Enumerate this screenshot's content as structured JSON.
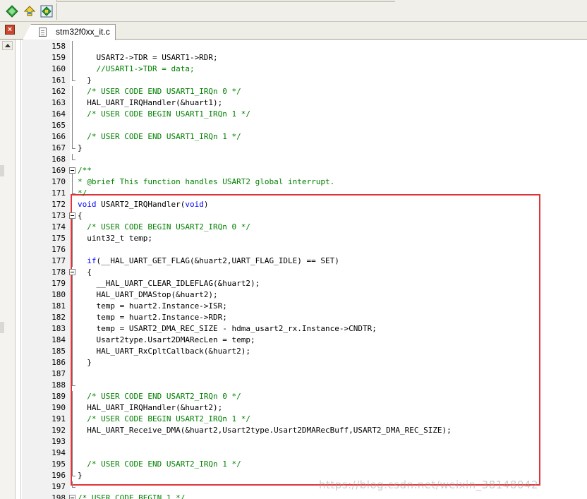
{
  "editor": {
    "tab_title": "stm32f0xx_it.c",
    "close_glyph": "×",
    "watermark": "https://blog.csdn.net/weixin_38148042",
    "colors": {
      "comment": "#008000",
      "keyword": "#0000ff",
      "highlight_border": "#e0343a"
    },
    "icons": [
      "navigate-green-icon",
      "bookmark-up-icon",
      "bookmark-window-icon",
      "file-icon",
      "close-icon",
      "scroll-up-icon"
    ],
    "lines": [
      {
        "n": "158",
        "fold": "line",
        "parts": []
      },
      {
        "n": "159",
        "fold": "line",
        "parts": [
          {
            "t": "    USART2->TDR = USART1->RDR;"
          }
        ]
      },
      {
        "n": "160",
        "fold": "line",
        "parts": [
          {
            "t": "    "
          },
          {
            "t": "//USART1->TDR = data;",
            "c": "com"
          }
        ]
      },
      {
        "n": "161",
        "fold": "end",
        "parts": [
          {
            "t": "  }"
          }
        ]
      },
      {
        "n": "162",
        "fold": "line",
        "parts": [
          {
            "t": "  "
          },
          {
            "t": "/* USER CODE END USART1_IRQn 0 */",
            "c": "com"
          }
        ]
      },
      {
        "n": "163",
        "fold": "line",
        "parts": [
          {
            "t": "  HAL_UART_IRQHandler(&huart1);"
          }
        ]
      },
      {
        "n": "164",
        "fold": "line",
        "parts": [
          {
            "t": "  "
          },
          {
            "t": "/* USER CODE BEGIN USART1_IRQn 1 */",
            "c": "com"
          }
        ]
      },
      {
        "n": "165",
        "fold": "line",
        "parts": []
      },
      {
        "n": "166",
        "fold": "line",
        "parts": [
          {
            "t": "  "
          },
          {
            "t": "/* USER CODE END USART1_IRQn 1 */",
            "c": "com"
          }
        ]
      },
      {
        "n": "167",
        "fold": "end",
        "parts": [
          {
            "t": "}"
          }
        ]
      },
      {
        "n": "168",
        "fold": "end",
        "parts": []
      },
      {
        "n": "169",
        "fold": "box",
        "parts": [
          {
            "t": "/**",
            "c": "com"
          }
        ]
      },
      {
        "n": "170",
        "fold": "line",
        "parts": [
          {
            "t": "* @brief This function handles USART2 global interrupt.",
            "c": "com"
          }
        ]
      },
      {
        "n": "171",
        "fold": "end",
        "parts": [
          {
            "t": "*/",
            "c": "com"
          }
        ]
      },
      {
        "n": "172",
        "fold": "none",
        "parts": [
          {
            "t": "void",
            "c": "kw"
          },
          {
            "t": " USART2_IRQHandler("
          },
          {
            "t": "void",
            "c": "kw"
          },
          {
            "t": ")"
          }
        ]
      },
      {
        "n": "173",
        "fold": "box",
        "parts": [
          {
            "t": "{"
          }
        ]
      },
      {
        "n": "174",
        "fold": "line",
        "parts": [
          {
            "t": "  "
          },
          {
            "t": "/* USER CODE BEGIN USART2_IRQn 0 */",
            "c": "com"
          }
        ]
      },
      {
        "n": "175",
        "fold": "line",
        "parts": [
          {
            "t": "  uint32_t temp;"
          }
        ]
      },
      {
        "n": "176",
        "fold": "line",
        "parts": []
      },
      {
        "n": "177",
        "fold": "line",
        "parts": [
          {
            "t": "  "
          },
          {
            "t": "if",
            "c": "kw"
          },
          {
            "t": "(__HAL_UART_GET_FLAG(&huart2,UART_FLAG_IDLE) == SET)"
          }
        ]
      },
      {
        "n": "178",
        "fold": "box",
        "parts": [
          {
            "t": "  {"
          }
        ]
      },
      {
        "n": "179",
        "fold": "line",
        "parts": [
          {
            "t": "    __HAL_UART_CLEAR_IDLEFLAG(&huart2);"
          }
        ]
      },
      {
        "n": "180",
        "fold": "line",
        "parts": [
          {
            "t": "    HAL_UART_DMAStop(&huart2);"
          }
        ]
      },
      {
        "n": "181",
        "fold": "line",
        "parts": [
          {
            "t": "    temp = huart2.Instance->ISR;"
          }
        ]
      },
      {
        "n": "182",
        "fold": "line",
        "parts": [
          {
            "t": "    temp = huart2.Instance->RDR;"
          }
        ]
      },
      {
        "n": "183",
        "fold": "line",
        "parts": [
          {
            "t": "    temp = USART2_DMA_REC_SIZE - hdma_usart2_rx.Instance->CNDTR;"
          }
        ]
      },
      {
        "n": "184",
        "fold": "line",
        "parts": [
          {
            "t": "    Usart2type.Usart2DMARecLen = temp;"
          }
        ]
      },
      {
        "n": "185",
        "fold": "line",
        "parts": [
          {
            "t": "    HAL_UART_RxCpltCallback(&huart2);"
          }
        ]
      },
      {
        "n": "186",
        "fold": "line",
        "parts": [
          {
            "t": "  }"
          }
        ]
      },
      {
        "n": "187",
        "fold": "line",
        "parts": []
      },
      {
        "n": "188",
        "fold": "end",
        "parts": []
      },
      {
        "n": "189",
        "fold": "line",
        "parts": [
          {
            "t": "  "
          },
          {
            "t": "/* USER CODE END USART2_IRQn 0 */",
            "c": "com"
          }
        ]
      },
      {
        "n": "190",
        "fold": "line",
        "parts": [
          {
            "t": "  HAL_UART_IRQHandler(&huart2);"
          }
        ]
      },
      {
        "n": "191",
        "fold": "line",
        "parts": [
          {
            "t": "  "
          },
          {
            "t": "/* USER CODE BEGIN USART2_IRQn 1 */",
            "c": "com"
          }
        ]
      },
      {
        "n": "192",
        "fold": "line",
        "parts": [
          {
            "t": "  HAL_UART_Receive_DMA(&huart2,Usart2type.Usart2DMARecBuff,USART2_DMA_REC_SIZE);"
          }
        ]
      },
      {
        "n": "193",
        "fold": "line",
        "parts": []
      },
      {
        "n": "194",
        "fold": "line",
        "parts": []
      },
      {
        "n": "195",
        "fold": "line",
        "parts": [
          {
            "t": "  "
          },
          {
            "t": "/* USER CODE END USART2_IRQn 1 */",
            "c": "com"
          }
        ]
      },
      {
        "n": "196",
        "fold": "end",
        "parts": [
          {
            "t": "}"
          }
        ]
      },
      {
        "n": "197",
        "fold": "end",
        "parts": []
      },
      {
        "n": "198",
        "fold": "box",
        "parts": [
          {
            "t": "/* USER CODE BEGIN 1 */",
            "c": "com"
          }
        ]
      }
    ]
  }
}
